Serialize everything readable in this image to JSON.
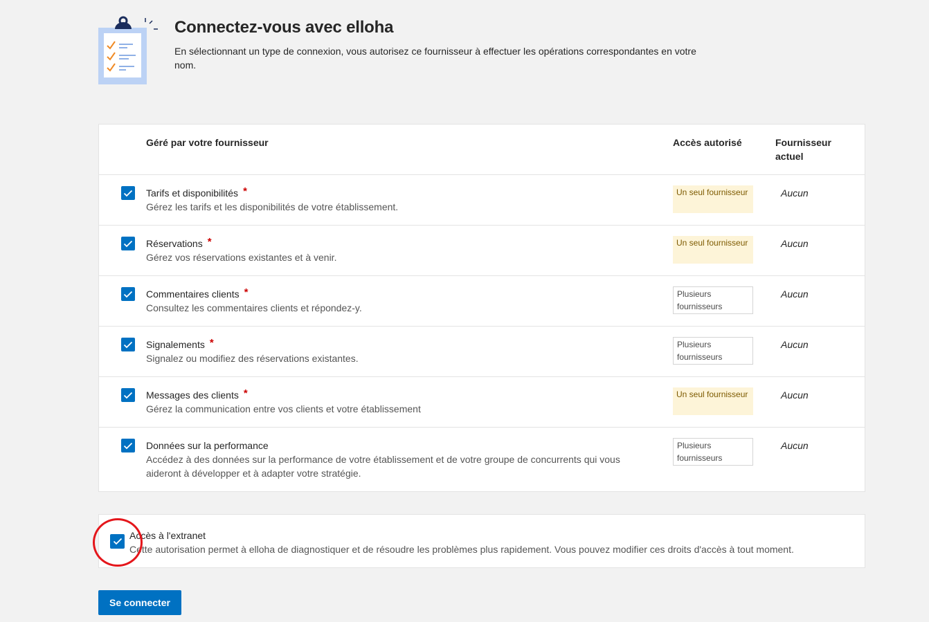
{
  "header": {
    "title": "Connectez-vous avec elloha",
    "description": "En sélectionnant un type de connexion, vous autorisez ce fournisseur à effectuer les opérations correspondantes en votre nom.",
    "illustration_icon": "clipboard-checklist-icon"
  },
  "table": {
    "headers": {
      "managed": "Géré par votre fournisseur",
      "access": "Accès autorisé",
      "current": "Fournisseur actuel"
    },
    "rows": [
      {
        "title": "Tarifs et disponibilités",
        "required": "*",
        "description": "Gérez les tarifs et les disponibilités de votre établissement.",
        "access": "Un seul fournisseur",
        "access_type": "single",
        "current": "Aucun",
        "checked": true
      },
      {
        "title": "Réservations",
        "required": "*",
        "description": "Gérez vos réservations existantes et à venir.",
        "access": "Un seul fournisseur",
        "access_type": "single",
        "current": "Aucun",
        "checked": true
      },
      {
        "title": "Commentaires clients",
        "required": "*",
        "description": "Consultez les commentaires clients et répondez-y.",
        "access": "Plusieurs fournisseurs",
        "access_type": "multiple",
        "current": "Aucun",
        "checked": true
      },
      {
        "title": "Signalements",
        "required": "*",
        "description": "Signalez ou modifiez des réservations existantes.",
        "access": "Plusieurs fournisseurs",
        "access_type": "multiple",
        "current": "Aucun",
        "checked": true
      },
      {
        "title": "Messages des clients",
        "required": "*",
        "description": "Gérez la communication entre vos clients et votre établissement",
        "access": "Un seul fournisseur",
        "access_type": "single",
        "current": "Aucun",
        "checked": true
      },
      {
        "title": "Données sur la performance",
        "required": "",
        "description": "Accédez à des données sur la performance de votre établissement et de votre groupe de concurrents qui vous aideront à développer et à adapter votre stratégie.",
        "access": "Plusieurs fournisseurs",
        "access_type": "multiple",
        "current": "Aucun",
        "checked": true
      }
    ]
  },
  "extranet": {
    "title": "Accès à l'extranet",
    "description": "Cette autorisation permet à elloha de diagnostiquer et de résoudre les problèmes plus rapidement. Vous pouvez modifier ces droits d'accès à tout moment.",
    "checked": true
  },
  "actions": {
    "connect_label": "Se connecter"
  },
  "colors": {
    "primary": "#0071c2",
    "required": "#cc0000",
    "single_badge_bg": "#fdf4d8",
    "single_badge_text": "#7d5a00",
    "highlight": "#e4161b",
    "page_bg": "#f2f2f2"
  }
}
